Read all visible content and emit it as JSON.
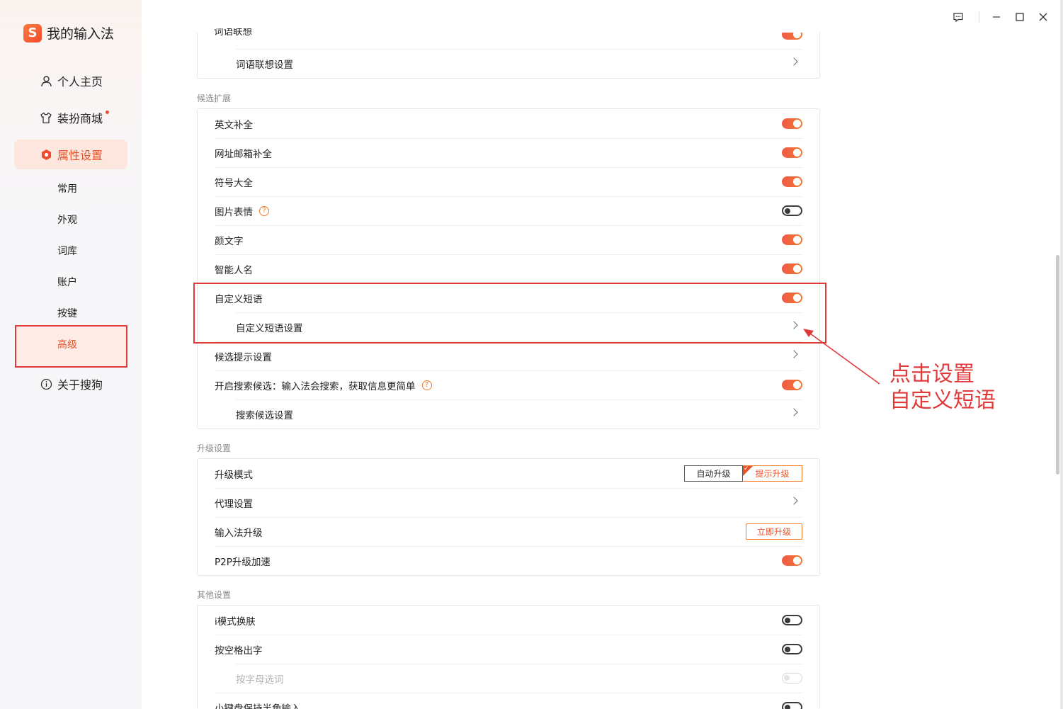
{
  "app": {
    "brand_logo": "S",
    "brand_name": "我的输入法"
  },
  "sidebar": {
    "items": [
      {
        "label": "个人主页",
        "icon": "user-icon"
      },
      {
        "label": "装扮商城",
        "icon": "tshirt-icon",
        "has_dot": true
      },
      {
        "label": "属性设置",
        "icon": "settings-hex-icon",
        "active": true
      },
      {
        "label": "关于搜狗",
        "icon": "info-icon"
      }
    ],
    "sub_items": [
      {
        "label": "常用"
      },
      {
        "label": "外观"
      },
      {
        "label": "词库"
      },
      {
        "label": "账户"
      },
      {
        "label": "按键"
      },
      {
        "label": "高级",
        "active": true
      }
    ]
  },
  "window_controls": [
    "feedback-icon",
    "minimize-icon",
    "maximize-icon",
    "close-icon"
  ],
  "sections": {
    "top_partial": {
      "rows": [
        {
          "label": "词语联想",
          "control": "toggle-on"
        },
        {
          "label": "词语联想设置",
          "control": "chevron",
          "sub": true
        }
      ]
    },
    "candidate_ext": {
      "title": "候选扩展",
      "rows": [
        {
          "label": "英文补全",
          "control": "toggle-on"
        },
        {
          "label": "网址邮箱补全",
          "control": "toggle-on"
        },
        {
          "label": "符号大全",
          "control": "toggle-on"
        },
        {
          "label": "图片表情",
          "control": "toggle-off",
          "help": true
        },
        {
          "label": "颜文字",
          "control": "toggle-on"
        },
        {
          "label": "智能人名",
          "control": "toggle-on"
        },
        {
          "label": "自定义短语",
          "control": "toggle-on"
        },
        {
          "label": "自定义短语设置",
          "control": "chevron",
          "sub": true
        },
        {
          "label": "候选提示设置",
          "control": "chevron"
        },
        {
          "label": "开启搜索候选：输入法会搜索，获取信息更简单",
          "control": "toggle-on",
          "help": true
        },
        {
          "label": "搜索候选设置",
          "control": "chevron",
          "sub": true
        }
      ]
    },
    "upgrade": {
      "title": "升级设置",
      "rows": [
        {
          "label": "升级模式",
          "control": "segment",
          "options": [
            "自动升级",
            "提示升级"
          ],
          "selected": "提示升级"
        },
        {
          "label": "代理设置",
          "control": "chevron"
        },
        {
          "label": "输入法升级",
          "control": "button",
          "button_label": "立即升级"
        },
        {
          "label": "P2P升级加速",
          "control": "toggle-on"
        }
      ]
    },
    "other": {
      "title": "其他设置",
      "rows": [
        {
          "label": "i模式换肤",
          "control": "toggle-off"
        },
        {
          "label": "按空格出字",
          "control": "toggle-off"
        },
        {
          "label": "按字母选词",
          "control": "toggle-disabled",
          "sub": true,
          "disabled": true
        },
        {
          "label": "小键盘保持半角输入",
          "control": "toggle-off"
        }
      ]
    }
  },
  "annotation": {
    "line1": "点击设置",
    "line2": "自定义短语",
    "color": "#e03a3a"
  },
  "colors": {
    "accent": "#e8552c",
    "toggle_on": "#f15a4a"
  }
}
